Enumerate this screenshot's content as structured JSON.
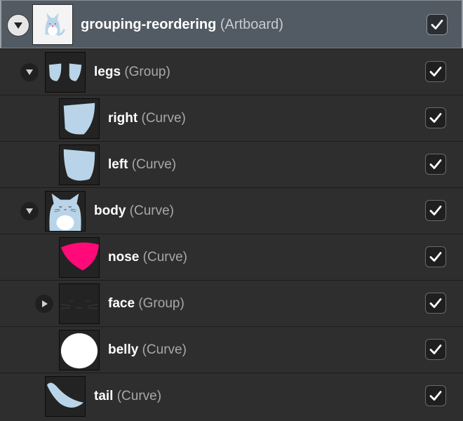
{
  "layers": [
    {
      "name": "grouping-reordering",
      "type": "(Artboard)",
      "toggle": "expanded",
      "thumb": "cat-artboard",
      "visible": true
    },
    {
      "name": "legs",
      "type": "(Group)",
      "toggle": "expanded",
      "thumb": "legs",
      "visible": true
    },
    {
      "name": "right",
      "type": "(Curve)",
      "toggle": "none",
      "thumb": "leg-right",
      "visible": true
    },
    {
      "name": "left",
      "type": "(Curve)",
      "toggle": "none",
      "thumb": "leg-left",
      "visible": true
    },
    {
      "name": "body",
      "type": "(Curve)",
      "toggle": "expanded",
      "thumb": "cat-body",
      "visible": true
    },
    {
      "name": "nose",
      "type": "(Curve)",
      "toggle": "none",
      "thumb": "nose",
      "visible": true
    },
    {
      "name": "face",
      "type": "(Group)",
      "toggle": "collapsed",
      "thumb": "face",
      "visible": true
    },
    {
      "name": "belly",
      "type": "(Curve)",
      "toggle": "none",
      "thumb": "belly",
      "visible": true
    },
    {
      "name": "tail",
      "type": "(Curve)",
      "toggle": "none",
      "thumb": "tail",
      "visible": true
    }
  ],
  "colors": {
    "selected_row": "#525a63",
    "row": "#2e2e2e",
    "cat_blue": "#b9d4e8",
    "nose_pink": "#ff0a78",
    "belly_white": "#ffffff"
  }
}
